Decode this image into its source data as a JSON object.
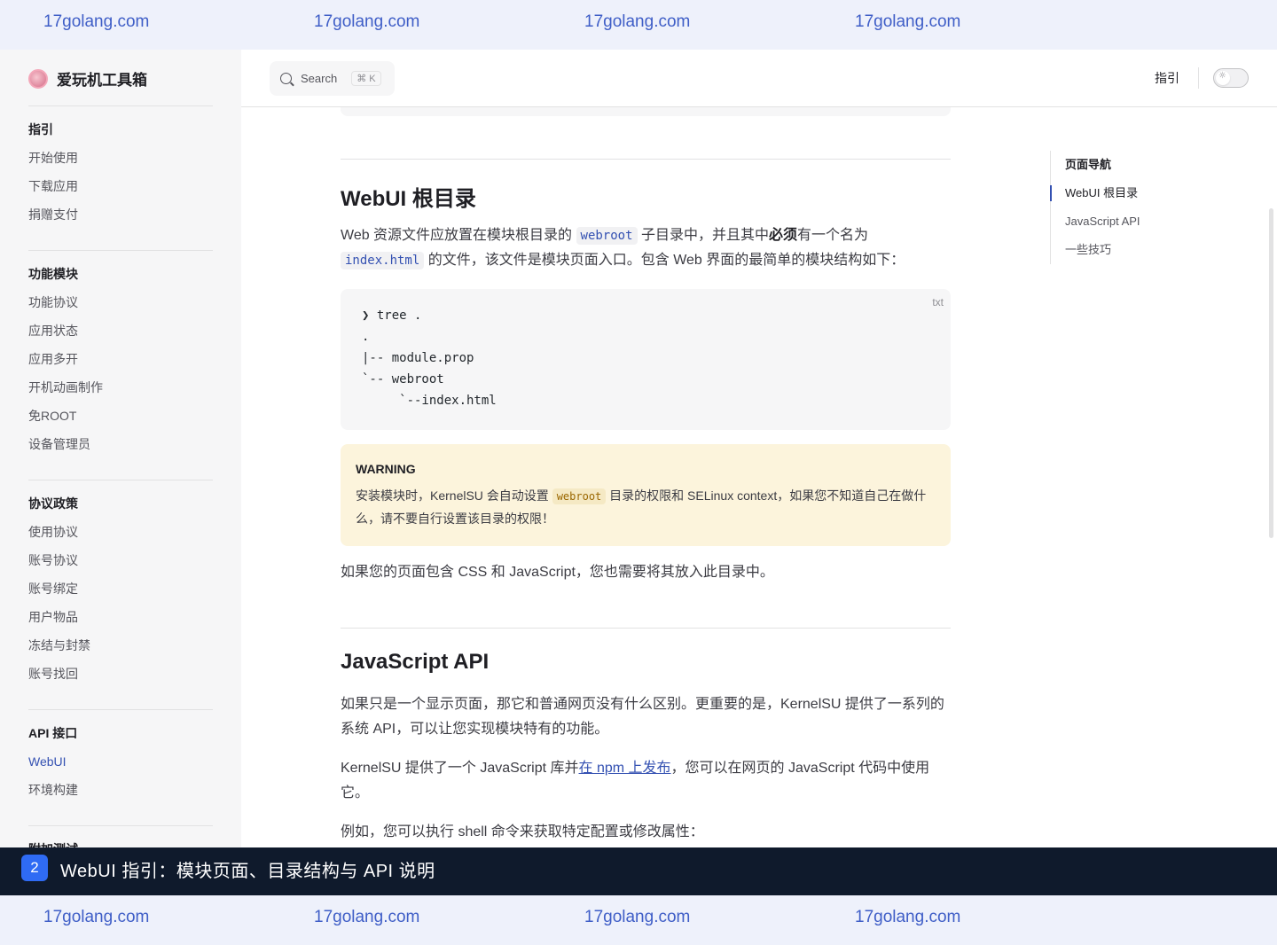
{
  "watermark": {
    "text": "17golang.com"
  },
  "sidebar": {
    "brand": "爱玩机工具箱",
    "groups": [
      {
        "title": "指引",
        "items": [
          "开始使用",
          "下载应用",
          "捐赠支付"
        ]
      },
      {
        "title": "功能模块",
        "items": [
          "功能协议",
          "应用状态",
          "应用多开",
          "开机动画制作",
          "免ROOT",
          "设备管理员"
        ]
      },
      {
        "title": "协议政策",
        "items": [
          "使用协议",
          "账号协议",
          "账号绑定",
          "用户物品",
          "冻结与封禁",
          "账号找回"
        ]
      },
      {
        "title": "API 接口",
        "items": [
          "WebUI",
          "环境构建"
        ]
      },
      {
        "title": "附加测试",
        "items": []
      }
    ],
    "active_item": "WebUI"
  },
  "topnav": {
    "search_label": "Search",
    "search_kbd": "⌘ K",
    "nav_link": "指引"
  },
  "main": {
    "section1": {
      "heading": "WebUI 根目录",
      "p1_a": "Web 资源文件应放置在模块根目录的 ",
      "p1_code": "webroot",
      "p1_b": " 子目录中，并且其中",
      "p1_bold": "必须",
      "p1_c": "有一个名为",
      "p1_code2": "index.html",
      "p1_d": " 的文件，该文件是模块页面入口。包含 Web 界面的最简单的模块结构如下：",
      "code_lang": "txt",
      "code": "❯ tree .\n.\n|-- module.prop\n`-- webroot\n     `--index.html",
      "warning_title": "WARNING",
      "warning_a": "安装模块时，KernelSU 会自动设置 ",
      "warning_code": "webroot",
      "warning_b": " 目录的权限和 SELinux context，如果您不知道自己在做什么，请不要自行设置该目录的权限！",
      "p2": "如果您的页面包含 CSS 和 JavaScript，您也需要将其放入此目录中。"
    },
    "section2": {
      "heading": "JavaScript API",
      "p1": "如果只是一个显示页面，那它和普通网页没有什么区别。更重要的是，KernelSU 提供了一系列的系统 API，可以让您实现模块特有的功能。",
      "p2_a": "KernelSU 提供了一个 JavaScript 库并",
      "p2_link": "在 npm 上发布",
      "p2_b": "，您可以在网页的 JavaScript 代码中使用它。",
      "p3": "例如，您可以执行 shell 命令来获取特定配置或修改属性："
    }
  },
  "aside": {
    "title": "页面导航",
    "items": [
      "WebUI 根目录",
      "JavaScript API",
      "一些技巧"
    ]
  },
  "caption": {
    "badge": "2",
    "text": "WebUI 指引：模块页面、目录结构与 API 说明"
  },
  "colors": {
    "accent": "#3451b2",
    "caption_bg": "#0f1a2c",
    "badge": "#2f6bf4",
    "warning_bg": "#fcf4dc",
    "watermark": "#3f5ec7"
  }
}
